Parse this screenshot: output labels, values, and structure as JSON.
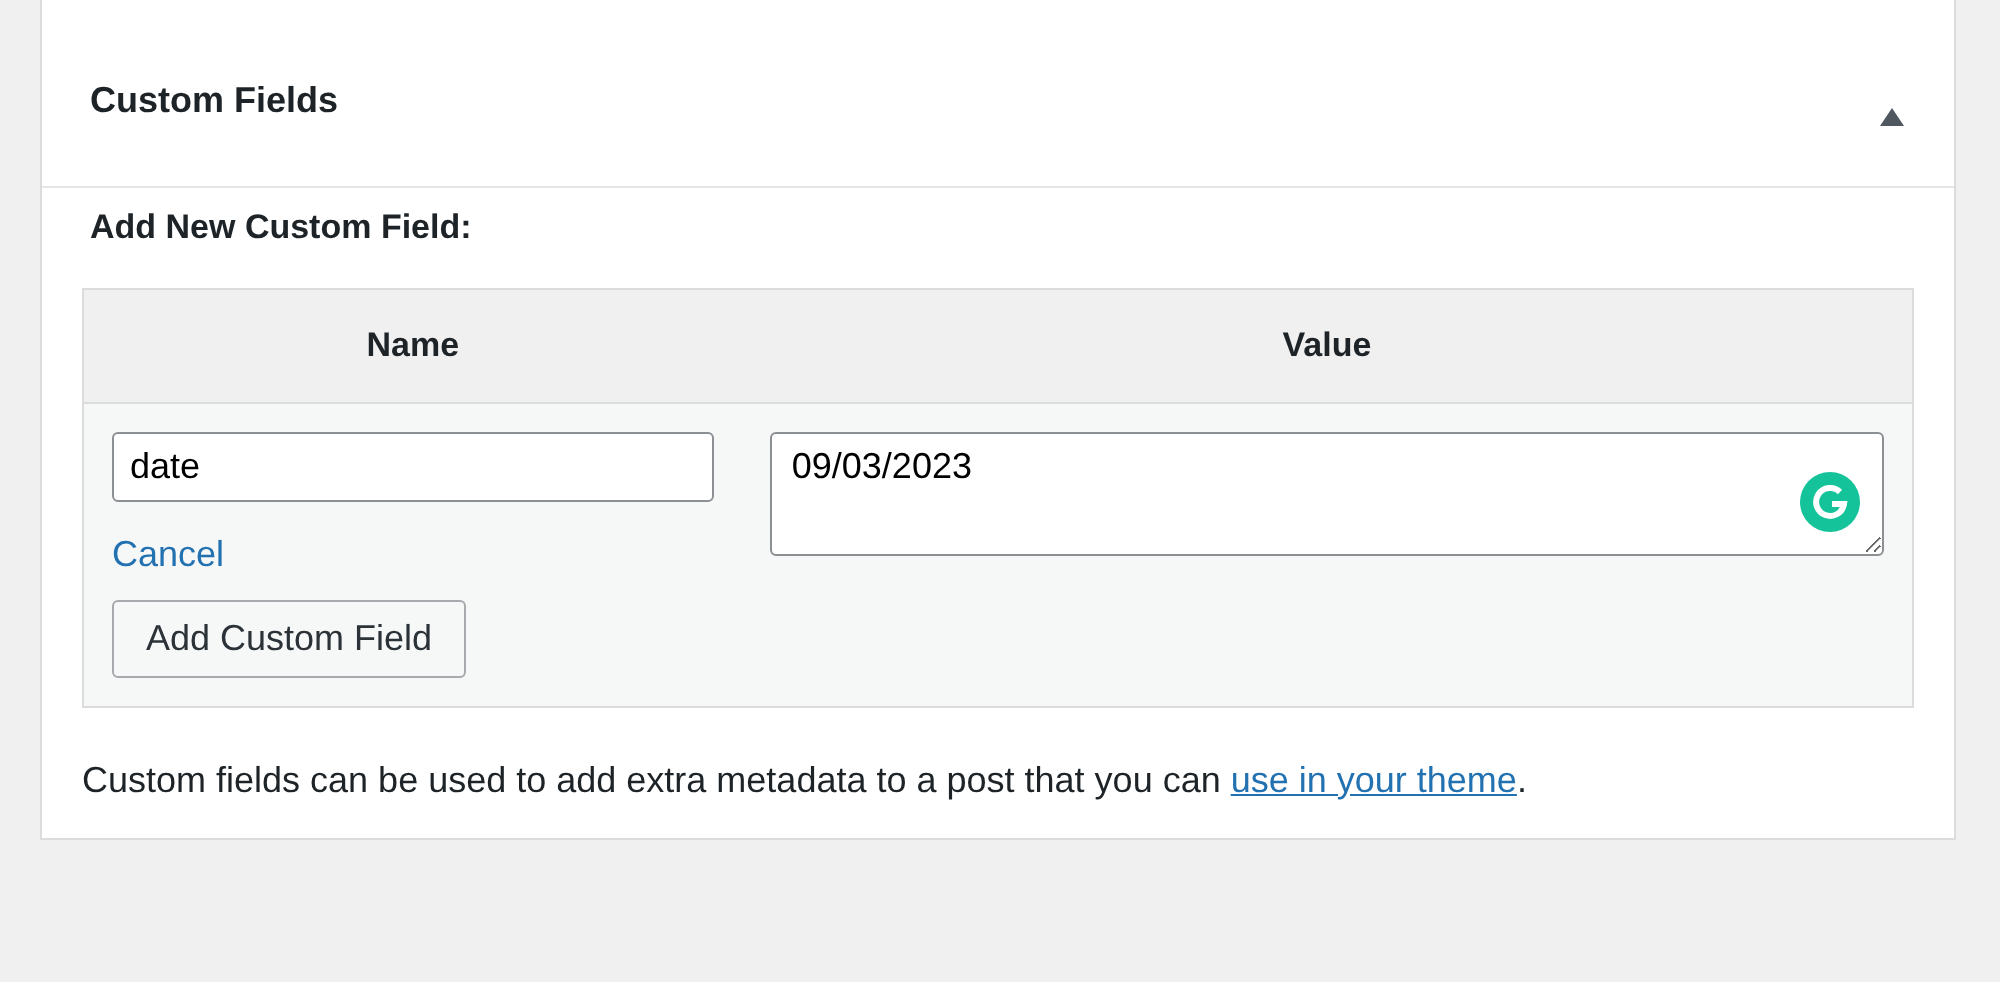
{
  "panel": {
    "title": "Custom Fields",
    "expanded": true
  },
  "form": {
    "heading": "Add New Custom Field:",
    "columns": [
      "Name",
      "Value"
    ],
    "name_value": "date",
    "value_value": "09/03/2023",
    "cancel": "Cancel",
    "add_button": "Add Custom Field"
  },
  "note": {
    "text": "Custom fields can be used to add extra metadata to a post that you can ",
    "link": "use in your theme",
    "end": "."
  }
}
